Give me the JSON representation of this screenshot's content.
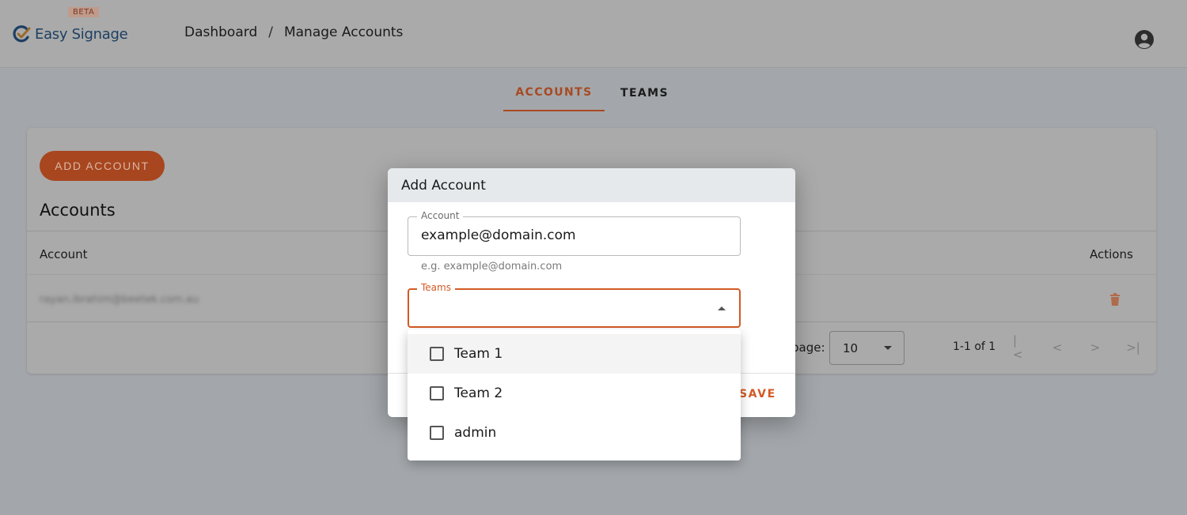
{
  "app": {
    "name": "Easy Signage",
    "badge": "BETA",
    "brand_color": "#1d3f62",
    "accent_color": "#d35a25"
  },
  "breadcrumb": [
    "Dashboard",
    "/",
    "Manage Accounts"
  ],
  "header": {
    "user_icon": "account-circle-icon"
  },
  "tabs": [
    {
      "label": "ACCOUNTS",
      "active": true
    },
    {
      "label": "TEAMS",
      "active": false
    }
  ],
  "accounts_card": {
    "add_button": "ADD ACCOUNT",
    "title": "Accounts",
    "columns": {
      "account": "Account",
      "actions": "Actions"
    },
    "rows": [
      {
        "account": "rayan.ibrahim@beetek.com.au",
        "action_icon": "trash-icon"
      }
    ],
    "pagination": {
      "rows_per_page_label": "page:",
      "rows_per_page": "10",
      "range": "1-1 of 1"
    }
  },
  "dialog": {
    "title": "Add Account",
    "account_field": {
      "label": "Account",
      "value": "example@domain.com",
      "helper": "e.g. example@domain.com"
    },
    "teams_field": {
      "label": "Teams",
      "value": ""
    },
    "save_label": "SAVE"
  },
  "teams_menu": [
    {
      "label": "Team 1",
      "checked": false
    },
    {
      "label": "Team 2",
      "checked": false
    },
    {
      "label": "admin",
      "checked": false
    }
  ]
}
